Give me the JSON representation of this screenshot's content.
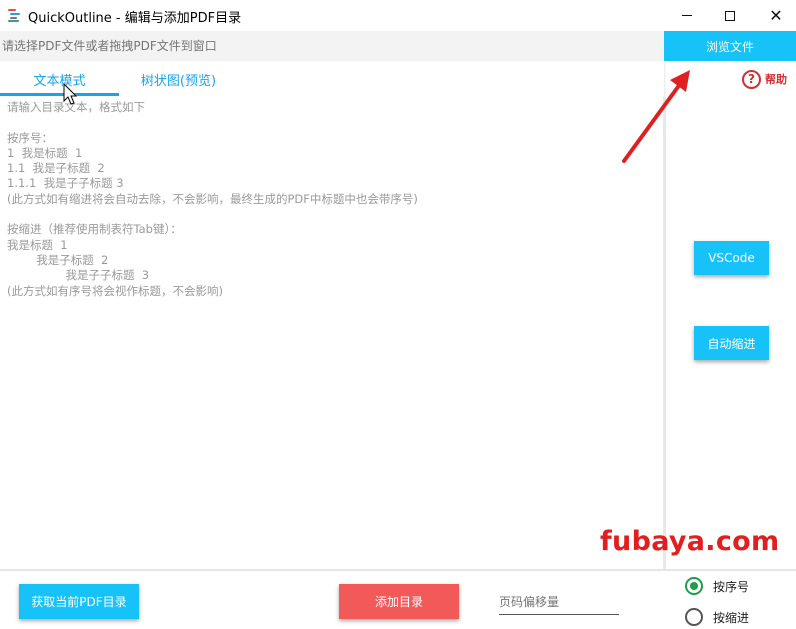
{
  "window": {
    "title": "QuickOutline - 编辑与添加PDF目录",
    "minimize_glyph": "",
    "close_glyph": "✕"
  },
  "file_bar": {
    "placeholder": "请选择PDF文件或者拖拽PDF文件到窗口",
    "browse_label": "浏览文件"
  },
  "tabs": [
    {
      "label": "文本模式",
      "active": true
    },
    {
      "label": "树状图(预览)",
      "active": false
    }
  ],
  "help": {
    "icon_glyph": "?",
    "label": "帮助"
  },
  "editor": {
    "placeholder": "请输入目录文本，格式如下\n\n按序号：\n1  我是标题  1\n1.1  我是子标题  2\n1.1.1  我是子子标题 3\n(此方式如有缩进将会自动去除，不会影响，最终生成的PDF中标题中也会带序号)\n\n按缩进（推荐使用制表符Tab键）：\n我是标题  1\n        我是子标题  2\n                我是子子标题  3\n(此方式如有序号将会视作标题，不会影响)"
  },
  "side_panel": {
    "vscode_label": "VSCode",
    "auto_indent_label": "自动缩进"
  },
  "watermark": "fubaya.com",
  "bottom": {
    "get_outline_label": "获取当前PDF目录",
    "add_outline_label": "添加目录",
    "offset_placeholder": "页码偏移量",
    "radio_sequence_label": "按序号",
    "radio_indent_label": "按缩进",
    "selected_mode": "按序号"
  },
  "colors": {
    "accent_blue": "#16c2f7",
    "tab_blue": "#1aa3e8",
    "add_red": "#f25a5a",
    "help_red": "#d32f2f",
    "radio_green": "#1e9e4a",
    "annotation_red": "#e02020"
  }
}
